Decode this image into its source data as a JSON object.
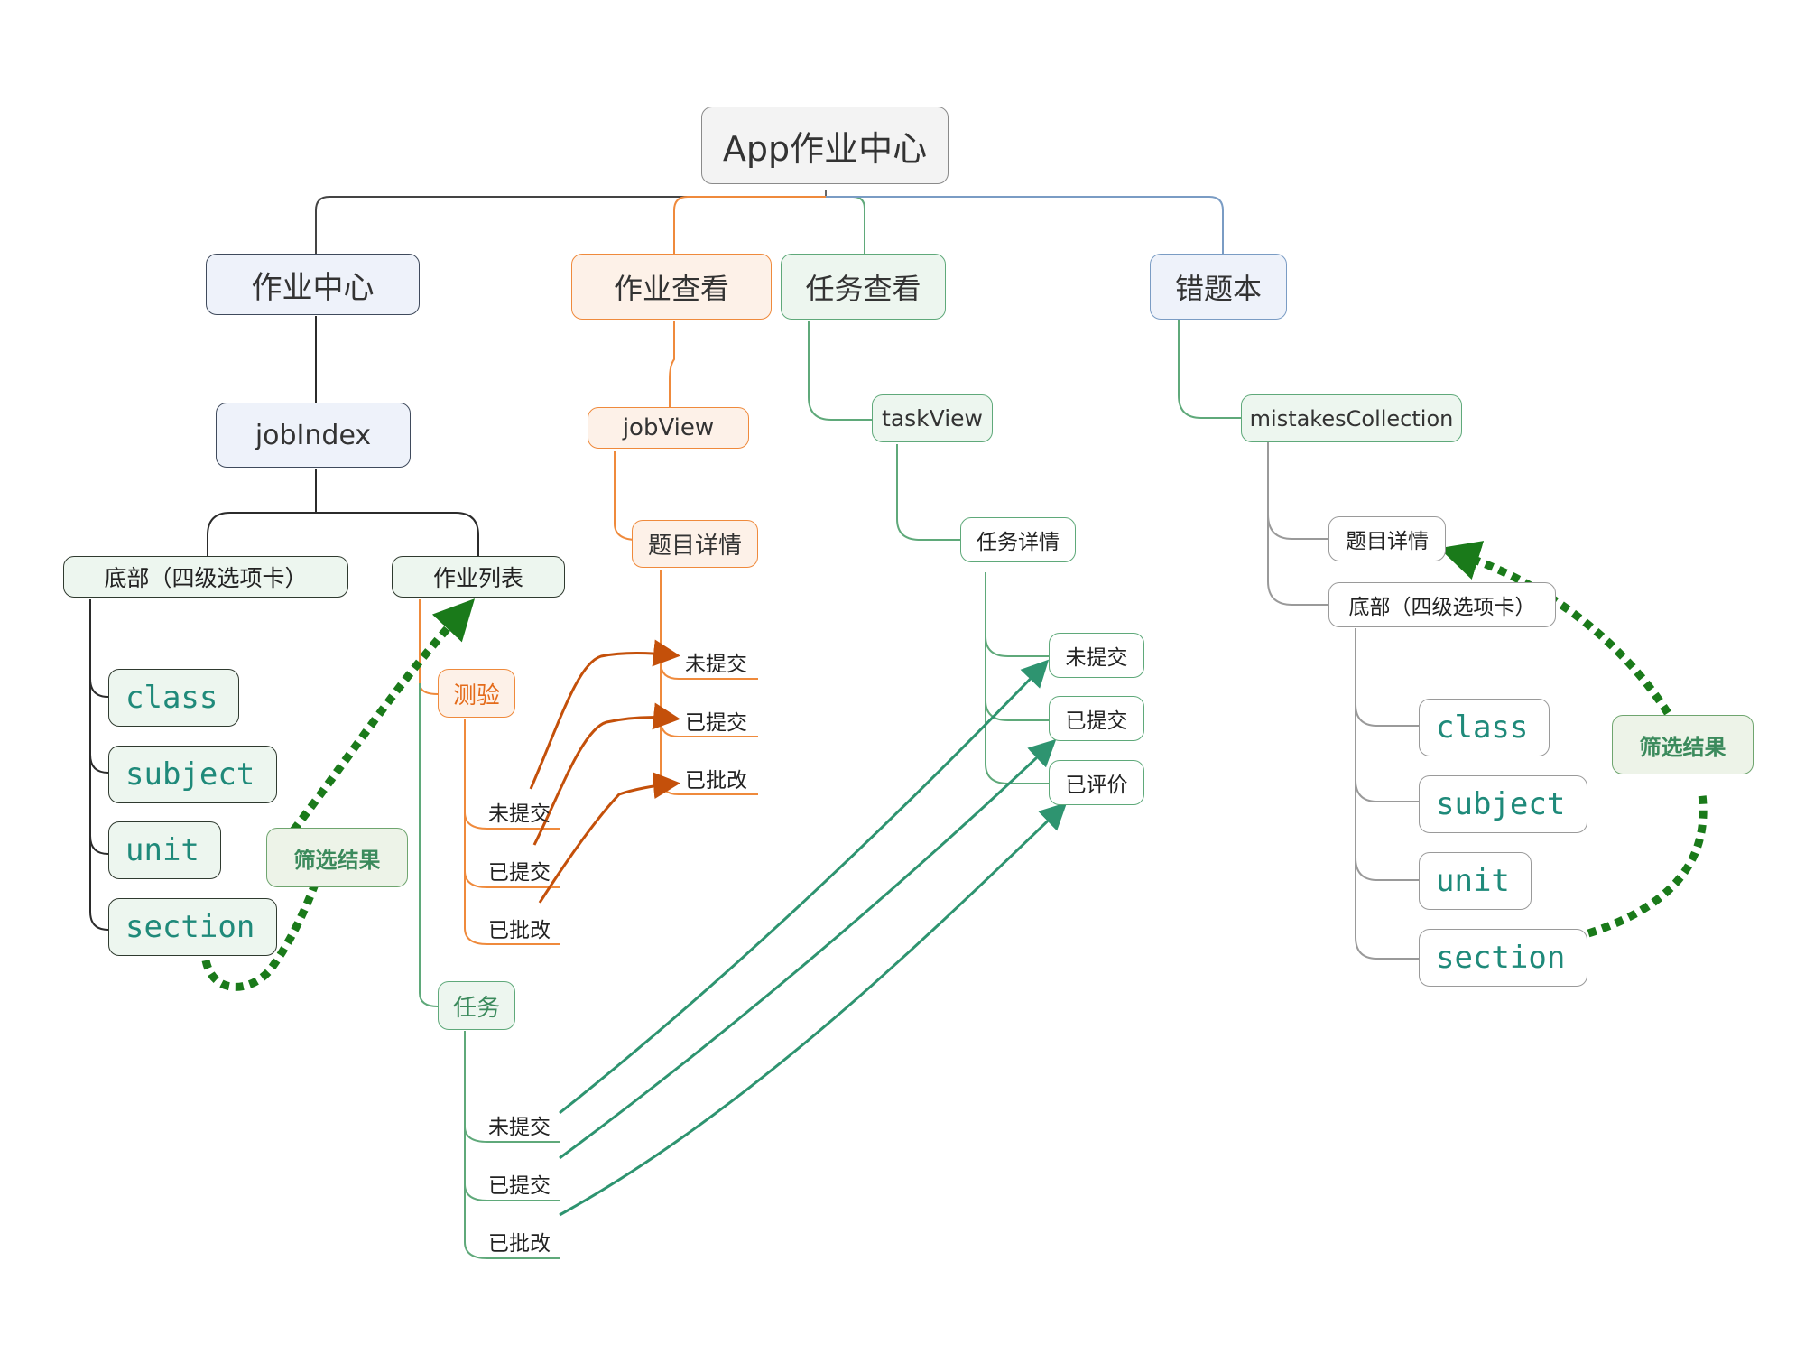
{
  "root": "App作业中心",
  "branches": {
    "job_center": {
      "title": "作业中心",
      "page": "jobIndex",
      "bottom_tabs": "底部（四级选项卡）",
      "job_list": "作业列表",
      "filters": [
        "class",
        "subject",
        "unit",
        "section"
      ],
      "filter_result": "筛选结果",
      "quiz": "测验",
      "quiz_status": [
        "未提交",
        "已提交",
        "已批改"
      ],
      "task": "任务",
      "task_status": [
        "未提交",
        "已提交",
        "已批改"
      ]
    },
    "job_view": {
      "title": "作业查看",
      "page": "jobView",
      "detail": "题目详情",
      "status": [
        "未提交",
        "已提交",
        "已批改"
      ]
    },
    "task_view": {
      "title": "任务查看",
      "page": "taskView",
      "detail": "任务详情",
      "status": [
        "未提交",
        "已提交",
        "已评价"
      ]
    },
    "mistakes": {
      "title": "错题本",
      "page": "mistakesCollection",
      "detail": "题目详情",
      "bottom_tabs": "底部（四级选项卡）",
      "filters": [
        "class",
        "subject",
        "unit",
        "section"
      ],
      "filter_result": "筛选结果"
    }
  },
  "colors": {
    "orange_arrow": "#c4500a",
    "teal_arrow": "#2e9470",
    "dotted_green": "#1a7a1a"
  }
}
